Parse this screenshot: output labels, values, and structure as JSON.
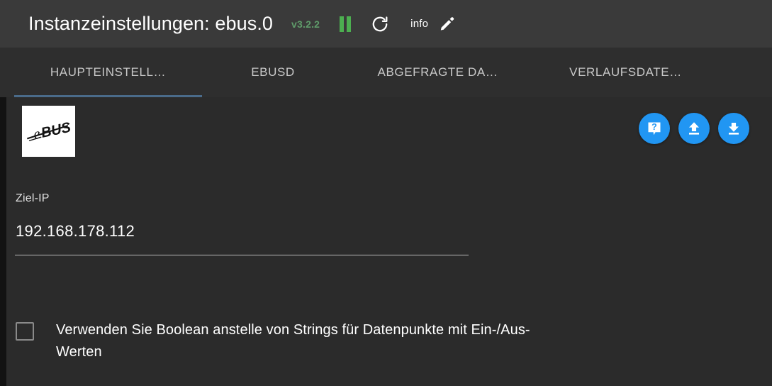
{
  "header": {
    "title": "Instanzeinstellungen: ebus.0",
    "version": "v3.2.2",
    "pause_icon": "pause-icon",
    "refresh_icon": "refresh-icon",
    "info_label": "info",
    "edit_icon": "pencil-icon",
    "version_color": "#5f9c6a",
    "pause_color": "#4caf50"
  },
  "tabs": [
    {
      "label": "HAUPTEINSTELL…",
      "active": true
    },
    {
      "label": "EBUSD",
      "active": false
    },
    {
      "label": "ABGEFRAGTE DA…",
      "active": false
    },
    {
      "label": "VERLAUFSDATE…",
      "active": false
    }
  ],
  "tab_accent_color": "#4a6b8a",
  "content": {
    "logo_alt": "eBUS",
    "logo_text": "eBUS",
    "actions": [
      {
        "name": "help-button",
        "icon": "question-mark-icon"
      },
      {
        "name": "upload-button",
        "icon": "upload-icon"
      },
      {
        "name": "download-button",
        "icon": "download-icon"
      }
    ],
    "action_color": "#2196f3",
    "target_ip": {
      "label": "Ziel-IP",
      "value": "192.168.178.112",
      "placeholder": "Ziel-IP"
    },
    "boolean_option": {
      "label": "Verwenden Sie Boolean anstelle von Strings für Datenpunkte mit Ein-/Aus-Werten",
      "checked": false
    }
  }
}
